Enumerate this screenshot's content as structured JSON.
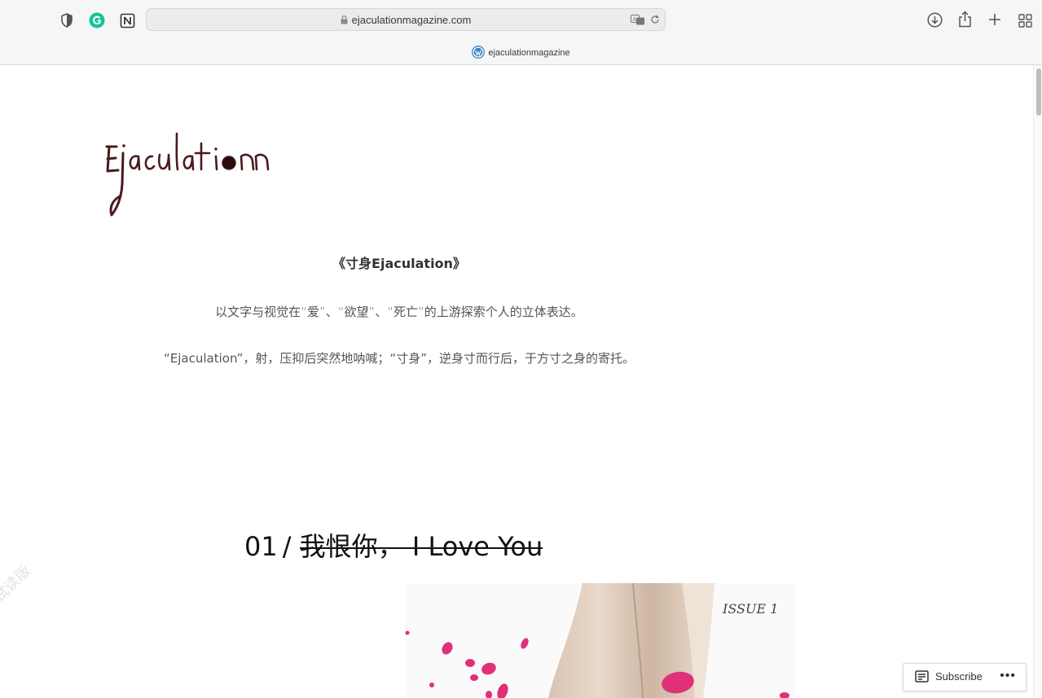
{
  "browser": {
    "url": "ejaculationmagazine.com",
    "tab_title": "ejaculationmagazine",
    "icons": [
      "privacy-shield-icon",
      "grammarly-icon",
      "notion-icon",
      "lock-icon",
      "translate-icon",
      "reload-icon",
      "download-icon",
      "share-icon",
      "new-tab-icon",
      "tab-overview-icon",
      "wordpress-icon"
    ]
  },
  "site": {
    "logo_text": "Ejaculation",
    "title": "《寸身Ejaculation》",
    "description_1": "以文字与视觉在“爱”、“欲望”、“死亡”的上游探索个人的立体表达。",
    "description_2": "“Ejaculation”，射，压抑后突然地呐喊；“寸身”，逆身寸而行后，于方寸之身的寄托。"
  },
  "issue": {
    "number": "01",
    "separator": "/",
    "title_main": "我恨你，",
    "title_struck": "I Love You",
    "cover_label": "ISSUE 1"
  },
  "watermark": "试读版",
  "subscribe_bar": {
    "label": "Subscribe",
    "more": "•••"
  },
  "colors": {
    "accent_grammarly": "#15c39a",
    "wordpress_blue": "#3582c4",
    "petal_pink": "#e0307a"
  }
}
